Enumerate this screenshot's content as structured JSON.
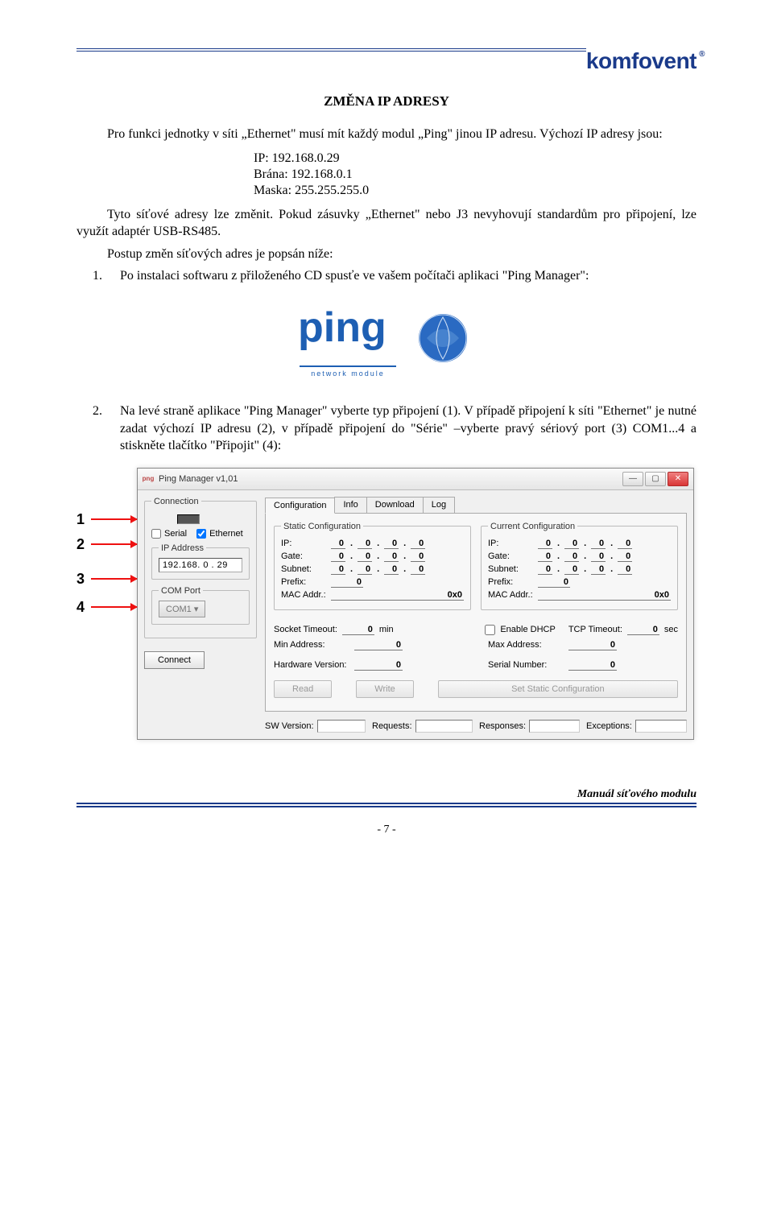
{
  "brand": "komfovent",
  "title": "ZMĚNA IP ADRESY",
  "intro": "Pro funkci jednotky v síti „Ethernet\" musí mít každý modul „Ping\" jinou IP adresu. Výchozí IP adresy jsou:",
  "defaults": {
    "ip": "IP: 192.168.0.29",
    "gate": "Brána: 192.168.0.1",
    "mask": "Maska: 255.255.255.0"
  },
  "para2": "Tyto síťové adresy lze změnit. Pokud zásuvky „Ethernet\" nebo J3 nevyhovují standardům pro připojení, lze využít adaptér USB-RS485.",
  "para3": "Postup změn síťových adres je popsán níže:",
  "steps": {
    "s1": "Po instalaci softwaru z přiloženého CD spusťe ve vašem počítači aplikaci     \"Ping Manager\":",
    "s2": "Na levé straně aplikace \"Ping Manager\" vyberte typ připojení (1). V případě připojení k síti \"Ethernet\" je nutné zadat výchozí IP adresu (2), v případě připojení do \"Série\" –vyberte pravý sériový port (3) COM1...4 a stiskněte tlačítko \"Připojit\" (4):"
  },
  "logo": {
    "sub": "network module"
  },
  "callouts": {
    "n1": "1",
    "n2": "2",
    "n3": "3",
    "n4": "4"
  },
  "pm": {
    "title": "Ping Manager v1,01",
    "conn": {
      "legend": "Connection",
      "serial": "Serial",
      "ethernet": "Ethernet",
      "ip_legend": "IP Address",
      "ip_value": "192.168. 0 . 29",
      "com_legend": "COM Port",
      "com_value": "COM1",
      "connect": "Connect"
    },
    "tabs": {
      "cfg": "Configuration",
      "info": "Info",
      "dl": "Download",
      "log": "Log"
    },
    "static": {
      "legend": "Static Configuration",
      "ip": "IP:",
      "gate": "Gate:",
      "subnet": "Subnet:",
      "prefix": "Prefix:",
      "mac": "MAC Addr.:",
      "mac_val": "0x0"
    },
    "current": {
      "legend": "Current Configuration",
      "mac_val": "0x0"
    },
    "mid": {
      "sock": "Socket Timeout:",
      "min": "min",
      "dhcp": "Enable DHCP",
      "tcp": "TCP Timeout:",
      "sec": "sec"
    },
    "low": {
      "minaddr": "Min Address:",
      "maxaddr": "Max Address:",
      "hw": "Hardware Version:",
      "sn": "Serial Number:"
    },
    "btns": {
      "read": "Read",
      "write": "Write",
      "set": "Set Static Configuration"
    },
    "status": {
      "sw": "SW Version:",
      "req": "Requests:",
      "resp": "Responses:",
      "exc": "Exceptions:"
    },
    "zero": "0"
  },
  "footer": {
    "label": "Manuál síťového modulu",
    "page": "- 7 -"
  }
}
